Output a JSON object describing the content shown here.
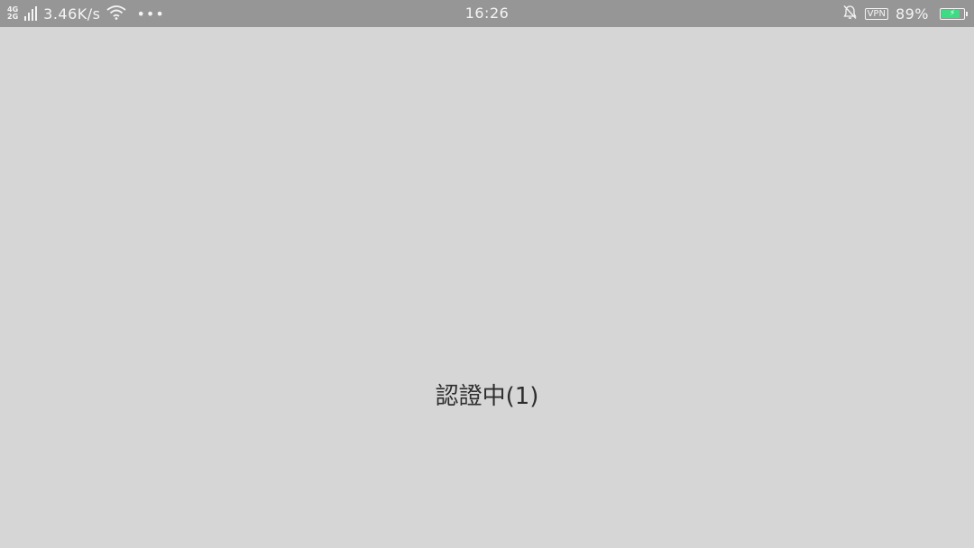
{
  "status_bar": {
    "network_type_top": "4G",
    "network_type_bottom": "2G",
    "net_speed": "3.46K/s",
    "more": "•••",
    "time": "16:26",
    "vpn": "VPN",
    "battery_percent": "89%",
    "battery_level": 0.89,
    "battery_color": "#3ddc84",
    "icons": [
      "signal-icon",
      "wifi-icon",
      "silent-bell-icon",
      "battery-charging-icon"
    ]
  },
  "main": {
    "status_text": "認證中(1)"
  }
}
